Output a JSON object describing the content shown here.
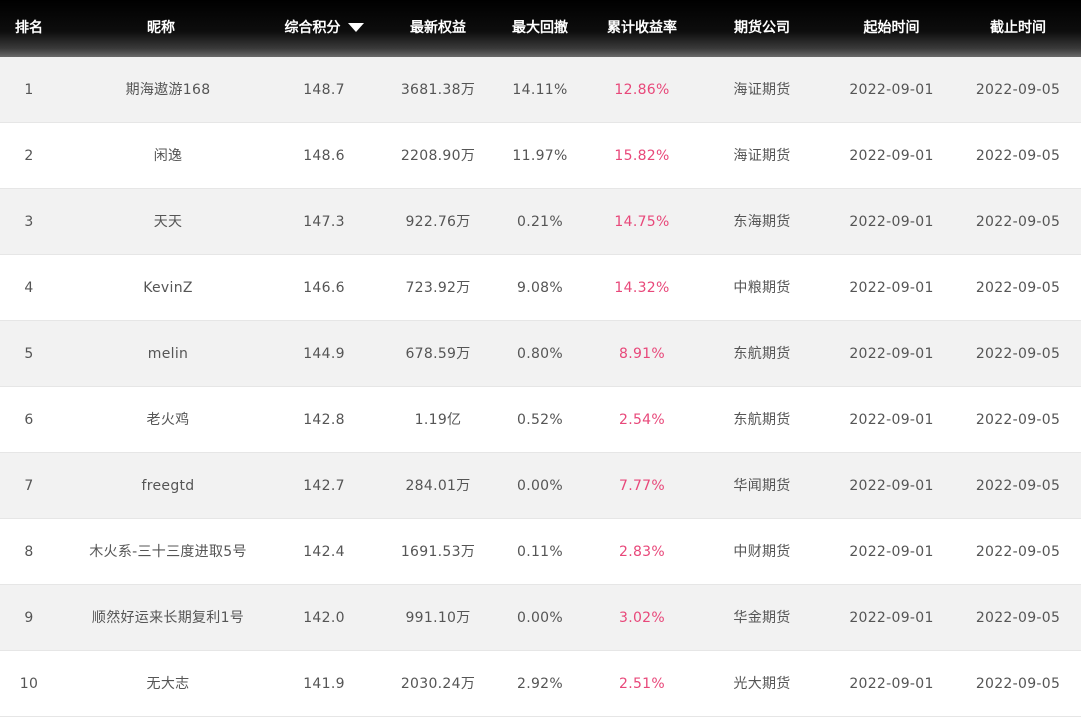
{
  "header": {
    "rank": "排名",
    "nickname": "昵称",
    "score": "综合积分",
    "equity": "最新权益",
    "drawdown": "最大回撤",
    "return": "累计收益率",
    "company": "期货公司",
    "start": "起始时间",
    "end": "截止时间"
  },
  "rows": [
    {
      "rank": "1",
      "nickname": "期海遨游168",
      "score": "148.7",
      "equity": "3681.38万",
      "drawdown": "14.11%",
      "return": "12.86%",
      "company": "海证期货",
      "start": "2022-09-01",
      "end": "2022-09-05"
    },
    {
      "rank": "2",
      "nickname": "闲逸",
      "score": "148.6",
      "equity": "2208.90万",
      "drawdown": "11.97%",
      "return": "15.82%",
      "company": "海证期货",
      "start": "2022-09-01",
      "end": "2022-09-05"
    },
    {
      "rank": "3",
      "nickname": "天天",
      "score": "147.3",
      "equity": "922.76万",
      "drawdown": "0.21%",
      "return": "14.75%",
      "company": "东海期货",
      "start": "2022-09-01",
      "end": "2022-09-05"
    },
    {
      "rank": "4",
      "nickname": "KevinZ",
      "score": "146.6",
      "equity": "723.92万",
      "drawdown": "9.08%",
      "return": "14.32%",
      "company": "中粮期货",
      "start": "2022-09-01",
      "end": "2022-09-05"
    },
    {
      "rank": "5",
      "nickname": "melin",
      "score": "144.9",
      "equity": "678.59万",
      "drawdown": "0.80%",
      "return": "8.91%",
      "company": "东航期货",
      "start": "2022-09-01",
      "end": "2022-09-05"
    },
    {
      "rank": "6",
      "nickname": "老火鸡",
      "score": "142.8",
      "equity": "1.19亿",
      "drawdown": "0.52%",
      "return": "2.54%",
      "company": "东航期货",
      "start": "2022-09-01",
      "end": "2022-09-05"
    },
    {
      "rank": "7",
      "nickname": "freegtd",
      "score": "142.7",
      "equity": "284.01万",
      "drawdown": "0.00%",
      "return": "7.77%",
      "company": "华闻期货",
      "start": "2022-09-01",
      "end": "2022-09-05"
    },
    {
      "rank": "8",
      "nickname": "木火系-三十三度进取5号",
      "score": "142.4",
      "equity": "1691.53万",
      "drawdown": "0.11%",
      "return": "2.83%",
      "company": "中财期货",
      "start": "2022-09-01",
      "end": "2022-09-05"
    },
    {
      "rank": "9",
      "nickname": "顺然好运来长期复利1号",
      "score": "142.0",
      "equity": "991.10万",
      "drawdown": "0.00%",
      "return": "3.02%",
      "company": "华金期货",
      "start": "2022-09-01",
      "end": "2022-09-05"
    },
    {
      "rank": "10",
      "nickname": "无大志",
      "score": "141.9",
      "equity": "2030.24万",
      "drawdown": "2.92%",
      "return": "2.51%",
      "company": "光大期货",
      "start": "2022-09-01",
      "end": "2022-09-05"
    }
  ],
  "colors": {
    "header_bg": "#000000",
    "return_text": "#e8487a",
    "row_alt": "#f2f2f2",
    "text": "#555555"
  },
  "icons": {
    "sort": "sort-desc-icon"
  }
}
